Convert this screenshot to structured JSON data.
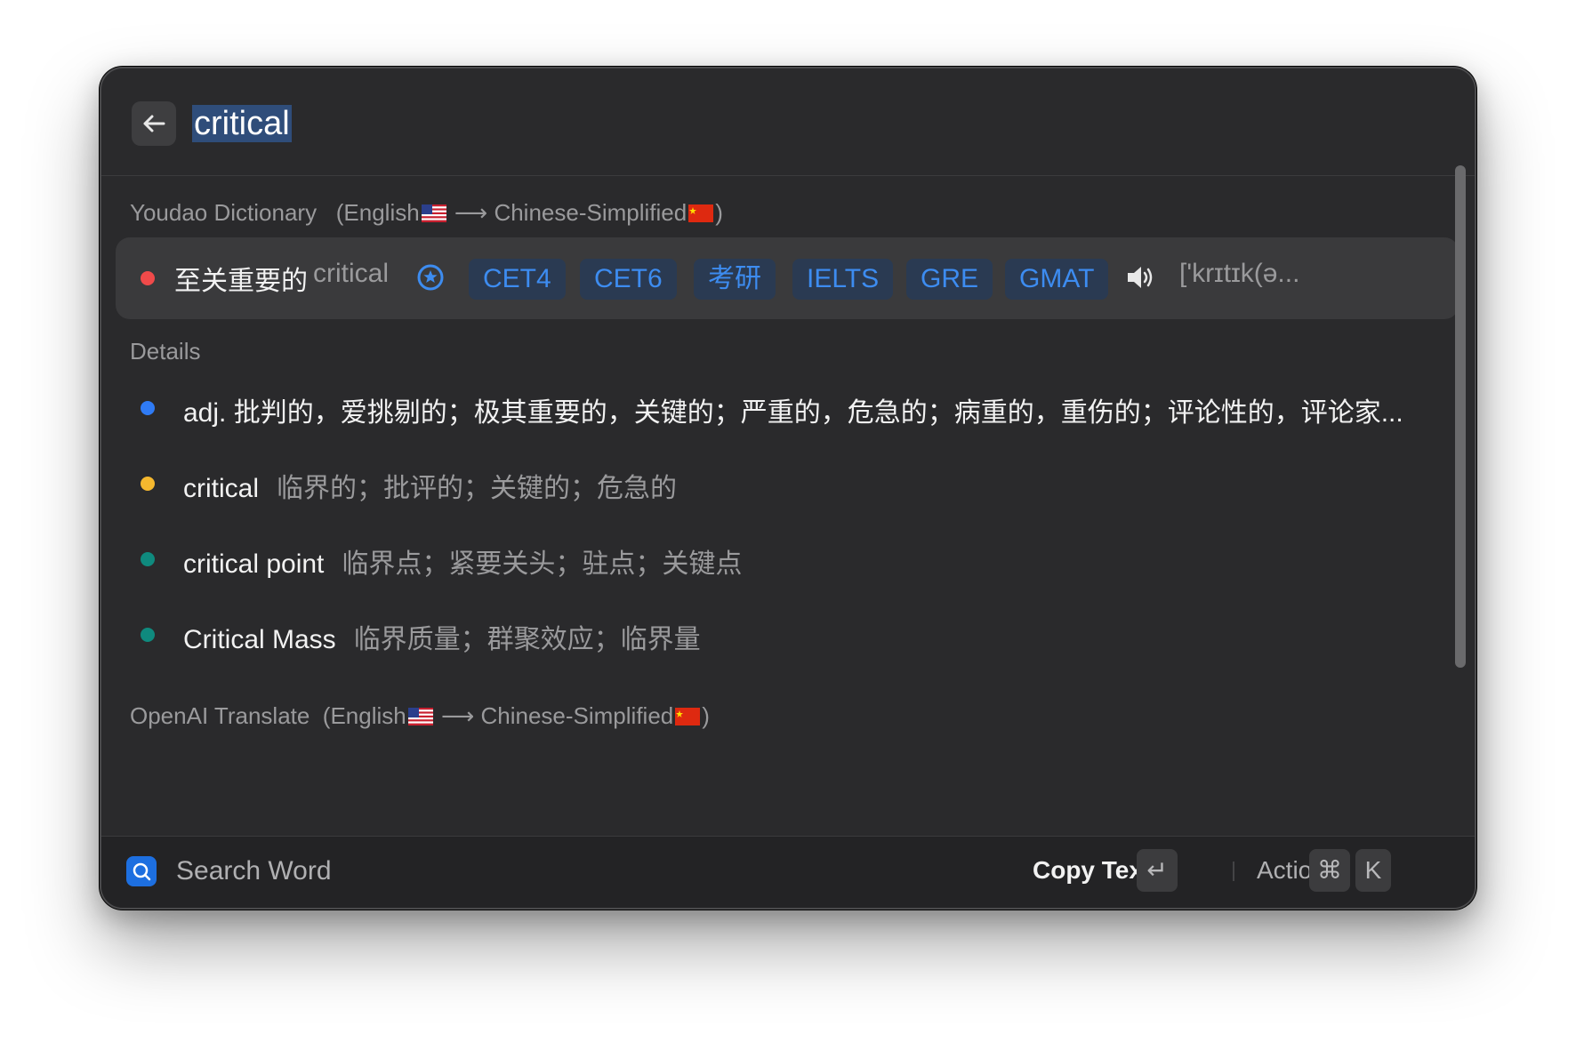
{
  "search": {
    "query": "critical",
    "back_icon": "arrow-left-icon"
  },
  "youdao": {
    "section_name": "Youdao Dictionary",
    "lang_from": "(English",
    "arrow": "⟶",
    "lang_to": "Chinese-Simplified",
    "close_paren": ")",
    "result": {
      "translation": "至关重要的",
      "word": "critical",
      "exam_tags": [
        "CET4",
        "CET6",
        "考研",
        "IELTS",
        "GRE",
        "GMAT"
      ],
      "phonetic": "['krɪtɪk(ə..."
    }
  },
  "details": {
    "title": "Details",
    "items": [
      {
        "term": "adj. 批判的，爱挑剔的；极其重要的，关键的；严重的，危急的；病重的，重伤的；评论性的，评论家...",
        "meaning": "",
        "color": "#2f7bf5"
      },
      {
        "term": "critical",
        "meaning": "临界的；批评的；关键的；危急的",
        "color": "#f5b82e"
      },
      {
        "term": "critical point",
        "meaning": "临界点；紧要关头；驻点；关键点",
        "color": "#0f8a7e"
      },
      {
        "term": "Critical Mass",
        "meaning": "临界质量；群聚效应；临界量",
        "color": "#0f8a7e"
      }
    ]
  },
  "openai": {
    "section_name": "OpenAI Translate",
    "lang_from": "(English",
    "arrow": "⟶",
    "lang_to": "Chinese-Simplified",
    "close_paren": ")"
  },
  "footer": {
    "title": "Search Word",
    "primary_action": "Copy Text",
    "enter_key": "↵",
    "actions_label": "Actions",
    "cmd_key": "⌘",
    "k_key": "K"
  },
  "colors": {
    "accent": "#3d8cf0",
    "red_dot": "#f04a4a",
    "window_bg": "#2a2a2c"
  }
}
